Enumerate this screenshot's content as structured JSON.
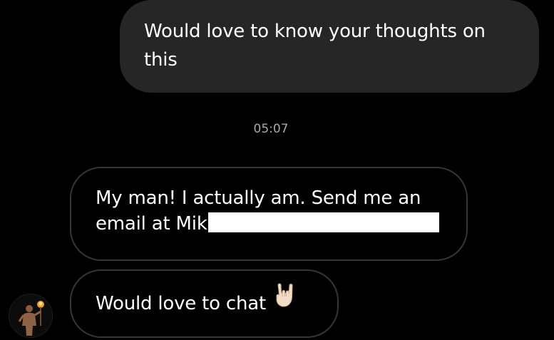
{
  "conversation": {
    "outgoing": [
      {
        "text": "Would love to know your thoughts on this"
      }
    ],
    "timestamp": "05:07",
    "incoming": [
      {
        "text": "My man! I actually am. Send me an email at Mik",
        "redacted": true
      },
      {
        "text": "Would love to chat",
        "emoji": "rock-on-hand"
      }
    ],
    "avatar": "profile-avatar-person-with-torch"
  },
  "colors": {
    "background": "#000000",
    "outgoing_bubble": "#262626",
    "incoming_border": "#363636",
    "timestamp": "#a8a8a8",
    "text": "#ffffff"
  }
}
